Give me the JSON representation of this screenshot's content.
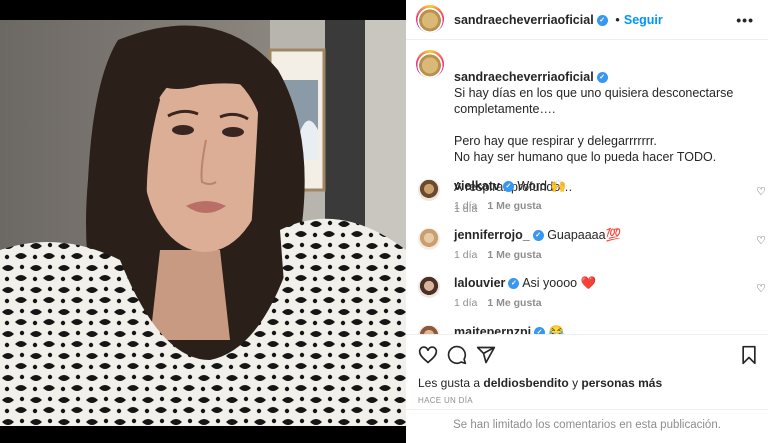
{
  "post": {
    "author": "sandraecheverriaoficial",
    "verified_mark": "✓",
    "follow_label": "Seguir",
    "more_label": "•••"
  },
  "caption": {
    "author": "sandraecheverriaoficial",
    "line1": "Si hay días en los que uno quisiera desconectarse completamente….",
    "line2": "Pero hay que respirar y delegarrrrrrr.\nNo hay ser humano que lo pueda hacer TODO.",
    "line3": "A respirar profundo…",
    "time": "1 día"
  },
  "comments": [
    {
      "user": "vielkatv",
      "text": "Word 🙌",
      "time": "1 día",
      "likes": "1 Me gusta"
    },
    {
      "user": "jenniferrojo_",
      "text": "Guapaaaa💯",
      "time": "1 día",
      "likes": "1 Me gusta"
    },
    {
      "user": "lalouvier",
      "text": "Asi yoooo ❤️",
      "time": "1 día",
      "likes": "1 Me gusta"
    },
    {
      "user": "maitepernzpi",
      "text": "😂",
      "time": "",
      "likes": ""
    }
  ],
  "likes_line": {
    "prefix": "Les gusta a ",
    "user": "deldiosbendito",
    "middle": " y ",
    "others": "personas más"
  },
  "post_date": "HACE UN DÍA",
  "comments_limited": "Se han limitado los comentarios en esta publicación.",
  "colors": {
    "accent": "#0095f6",
    "verified": "#3897f0",
    "muted": "#8e8e8e",
    "heart": "#ed4956"
  },
  "icons": [
    "more-icon",
    "heart-icon",
    "comment-icon",
    "share-icon",
    "bookmark-icon",
    "verified-icon"
  ]
}
